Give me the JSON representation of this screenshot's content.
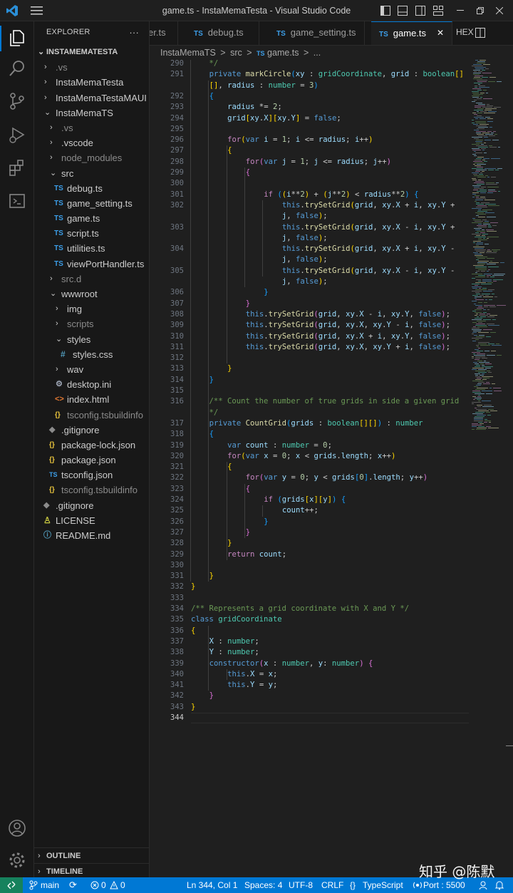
{
  "titlebar": {
    "title": "game.ts - InstaMemaTesta - Visual Studio Code"
  },
  "colors": {
    "accent": "#0078d4",
    "status_bg": "#0078d4",
    "remote_bg": "#16825d",
    "ts_icon": "#3c9ee8",
    "json_icon": "#e8c33c"
  },
  "explorer": {
    "header": "EXPLORER",
    "more": "···",
    "root": "INSTAMEMATESTA",
    "items": [
      {
        "label": ".vs"
      },
      {
        "label": "InstaMemaTesta"
      },
      {
        "label": "InstaMemaTestaMAUI"
      },
      {
        "label": "InstaMemaTS"
      },
      {
        "label": ".vs"
      },
      {
        "label": ".vscode"
      },
      {
        "label": "node_modules"
      },
      {
        "label": "src"
      },
      {
        "label": "debug.ts"
      },
      {
        "label": "game_setting.ts"
      },
      {
        "label": "game.ts"
      },
      {
        "label": "script.ts"
      },
      {
        "label": "utilities.ts"
      },
      {
        "label": "viewPortHandler.ts"
      },
      {
        "label": "src.d"
      },
      {
        "label": "wwwroot"
      },
      {
        "label": "img"
      },
      {
        "label": "scripts"
      },
      {
        "label": "styles"
      },
      {
        "label": "styles.css"
      },
      {
        "label": "wav"
      },
      {
        "label": "desktop.ini"
      },
      {
        "label": "index.html"
      },
      {
        "label": "tsconfig.tsbuildinfo"
      },
      {
        "label": ".gitignore"
      },
      {
        "label": "package-lock.json"
      },
      {
        "label": "package.json"
      },
      {
        "label": "tsconfig.json"
      },
      {
        "label": "tsconfig.tsbuildinfo"
      },
      {
        "label": ".gitignore"
      },
      {
        "label": "LICENSE"
      },
      {
        "label": "README.md"
      }
    ],
    "outline": "OUTLINE",
    "timeline": "TIMELINE"
  },
  "tabs": [
    {
      "label": "er.ts",
      "icon": ""
    },
    {
      "label": "debug.ts",
      "icon": "TS"
    },
    {
      "label": "game_setting.ts",
      "icon": "TS"
    },
    {
      "label": "game.ts",
      "icon": "TS"
    }
  ],
  "tab_actions": {
    "hex": "HEX",
    "close": "✕"
  },
  "breadcrumb": [
    "InstaMemaTS",
    "src",
    "game.ts",
    "..."
  ],
  "breadcrumb_sep": ">",
  "ts_badge": "TS",
  "gutter": [
    "290",
    "291",
    "",
    "292",
    "293",
    "294",
    "295",
    "296",
    "297",
    "298",
    "299",
    "300",
    "301",
    "302",
    "",
    "303",
    "",
    "304",
    "",
    "305",
    "",
    "306",
    "307",
    "308",
    "309",
    "310",
    "311",
    "312",
    "313",
    "314",
    "315",
    "316",
    "",
    "317",
    "318",
    "319",
    "320",
    "321",
    "322",
    "323",
    "324",
    "325",
    "326",
    "327",
    "328",
    "329",
    "330",
    "331",
    "332",
    "333",
    "334",
    "335",
    "336",
    "337",
    "338",
    "339",
    "340",
    "341",
    "342",
    "343",
    "344"
  ],
  "code_lines": [
    "    */",
    "    private markCircle(xy : gridCoordinate, grid : boolean[]",
    "    [], radius : number = 3)",
    "    {",
    "        radius *= 2;",
    "        grid[xy.X][xy.Y] = false;",
    "",
    "        for(var i = 1; i <= radius; i++)",
    "        {",
    "            for(var j = 1; j <= radius; j++)",
    "            {",
    "",
    "                if ((i**2) + (j**2) < radius**2) {",
    "                    this.trySetGrid(grid, xy.X + i, xy.Y +",
    "                    j, false);",
    "                    this.trySetGrid(grid, xy.X - i, xy.Y +",
    "                    j, false);",
    "                    this.trySetGrid(grid, xy.X + i, xy.Y -",
    "                    j, false);",
    "                    this.trySetGrid(grid, xy.X - i, xy.Y -",
    "                    j, false);",
    "                }",
    "            }",
    "            this.trySetGrid(grid, xy.X - i, xy.Y, false);",
    "            this.trySetGrid(grid, xy.X, xy.Y - i, false);",
    "            this.trySetGrid(grid, xy.X + i, xy.Y, false);",
    "            this.trySetGrid(grid, xy.X, xy.Y + i, false);",
    "",
    "        }",
    "    }",
    "",
    "    /** Count the number of true grids in side a given grid",
    "    */",
    "    private CountGrid(grids : boolean[][]) : number",
    "    {",
    "        var count : number = 0;",
    "        for(var x = 0; x < grids.length; x++)",
    "        {",
    "            for(var y = 0; y < grids[0].length; y++)",
    "            {",
    "                if (grids[x][y]) {",
    "                    count++;",
    "                }",
    "            }",
    "        }",
    "        return count;",
    "",
    "    }",
    "}",
    "",
    "/** Represents a grid coordinate with X and Y */",
    "class gridCoordinate",
    "{",
    "    X : number;",
    "    Y : number;",
    "    constructor(x : number, y: number) {",
    "        this.X = x;",
    "        this.Y = y;",
    "    }",
    "}",
    ""
  ],
  "status": {
    "branch": "main",
    "sync": "⟳",
    "errors": "0",
    "warnings": "0",
    "position": "Ln 344, Col 1",
    "spaces": "Spaces: 4",
    "encoding": "UTF-8",
    "eol": "CRLF",
    "braces": "{}",
    "language": "TypeScript",
    "port": "Port : 5500"
  },
  "watermark": "知乎 @陈默"
}
